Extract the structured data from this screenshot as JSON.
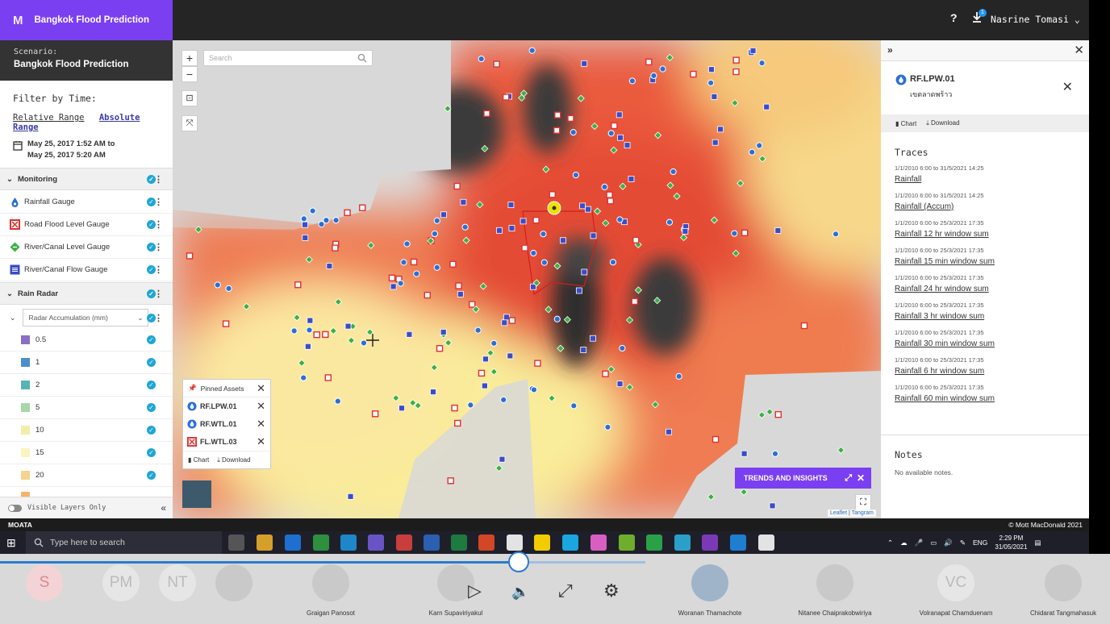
{
  "app": {
    "logo": "M",
    "title": "Bangkok Flood Prediction"
  },
  "header": {
    "help": "?",
    "badge_count": "1",
    "user": "Nasrine Tomasi ⌄"
  },
  "scenario": {
    "label": "Scenario:",
    "value": "Bangkok Flood Prediction"
  },
  "filter": {
    "title": "Filter by Time:",
    "relative": "Relative Range",
    "absolute": "Absolute Range",
    "date_from": "May 25, 2017 1:52 AM to",
    "date_to": "May 25, 2017 5:20 AM"
  },
  "monitoring": {
    "title": "Monitoring",
    "items": [
      {
        "label": "Rainfall Gauge",
        "icon": "rainfall-gauge-icon",
        "color": "#2a6fd6"
      },
      {
        "label": "Road Flood Level Gauge",
        "icon": "road-flood-gauge-icon",
        "color": "#e03030"
      },
      {
        "label": "River/Canal Level Gauge",
        "icon": "river-level-gauge-icon",
        "color": "#3cb043"
      },
      {
        "label": "River/Canal Flow Gauge",
        "icon": "river-flow-gauge-icon",
        "color": "#3a4cc8"
      }
    ]
  },
  "rain_radar": {
    "title": "Rain Radar",
    "select_value": "Radar Accumulation (mm)",
    "legend": [
      {
        "label": "0.5",
        "color": "#8a6fc6"
      },
      {
        "label": "1",
        "color": "#4a8fc9"
      },
      {
        "label": "2",
        "color": "#58b4b4"
      },
      {
        "label": "5",
        "color": "#a8d8a8"
      },
      {
        "label": "10",
        "color": "#f2eeaa"
      },
      {
        "label": "15",
        "color": "#fbf3c0"
      },
      {
        "label": "20",
        "color": "#f7d28c"
      }
    ]
  },
  "visible_layers": "Visible Layers Only",
  "map": {
    "search_placeholder": "Search",
    "zoom_in": "+",
    "zoom_out": "−",
    "pinned_title": "Pinned Assets",
    "pinned": [
      "RF.LPW.01",
      "RF.WTL.01",
      "FL.WTL.03"
    ],
    "pinned_chart": "Chart",
    "pinned_download": "Download",
    "trends": "TRENDS AND INSIGHTS",
    "attrib_leaflet": "Leaflet",
    "attrib_sep": " | ",
    "attrib_tangram": "Tangram"
  },
  "asset": {
    "name": "RF.LPW.01",
    "subtitle": "เขตลาดพร้าว",
    "chart": "Chart",
    "download": "Download"
  },
  "traces": {
    "title": "Traces",
    "items": [
      {
        "date": "1/1/2010 6:00 to 31/5/2021 14:25",
        "label": "Rainfall"
      },
      {
        "date": "1/1/2010 6:00 to 31/5/2021 14:25",
        "label": "Rainfall (Accum)"
      },
      {
        "date": "1/1/2010 6:00 to 25/3/2021 17:35",
        "label": "Rainfall 12 hr window sum"
      },
      {
        "date": "1/1/2010 6:00 to 25/3/2021 17:35",
        "label": "Rainfall 15 min window sum"
      },
      {
        "date": "1/1/2010 6:00 to 25/3/2021 17:35",
        "label": "Rainfall 24 hr window sum"
      },
      {
        "date": "1/1/2010 6:00 to 25/3/2021 17:35",
        "label": "Rainfall 3 hr window sum"
      },
      {
        "date": "1/1/2010 6:00 to 25/3/2021 17:35",
        "label": "Rainfall 30 min window sum"
      },
      {
        "date": "1/1/2010 6:00 to 25/3/2021 17:35",
        "label": "Rainfall 6 hr window sum"
      },
      {
        "date": "1/1/2010 6:00 to 25/3/2021 17:35",
        "label": "Rainfall 60 min window sum"
      }
    ]
  },
  "notes": {
    "title": "Notes",
    "value": "No available notes."
  },
  "footer": {
    "left": "MOATA",
    "right": "© Mott MacDonald 2021"
  },
  "taskbar": {
    "search": "Type here to search",
    "lang": "ENG",
    "time": "2:29 PM",
    "date": "31/05/2021"
  },
  "participants": [
    {
      "initials": "S",
      "name": "",
      "color": "#f3d3d5",
      "fg": "#d88b92"
    },
    {
      "initials": "PM",
      "name": "",
      "color": "#e6e6e6",
      "fg": "#bbbbbb"
    },
    {
      "initials": "NT",
      "name": "",
      "color": "#e6e6e6",
      "fg": "#bbbbbb"
    },
    {
      "initials": "",
      "name": "",
      "color": "#c9c9c9",
      "fg": "#888888"
    },
    {
      "initials": "",
      "name": "Graigan Panosot",
      "color": "#c9c9c9",
      "fg": "#888888"
    },
    {
      "initials": "",
      "name": "Karn Supaviriyakul",
      "color": "#c9c9c9",
      "fg": "#888888"
    },
    {
      "initials": "",
      "name": "Woranan Thamachote",
      "color": "#9fb4c8",
      "fg": "#ffffff"
    },
    {
      "initials": "",
      "name": "Nitanee Chaiprakobwiriya",
      "color": "#c9c9c9",
      "fg": "#888888"
    },
    {
      "initials": "VC",
      "name": "Volranapat Chamduenam",
      "color": "#e6e6e6",
      "fg": "#bbbbbb"
    },
    {
      "initials": "",
      "name": "Chidarat Tangmahasuk",
      "color": "#c9c9c9",
      "fg": "#888888"
    }
  ]
}
